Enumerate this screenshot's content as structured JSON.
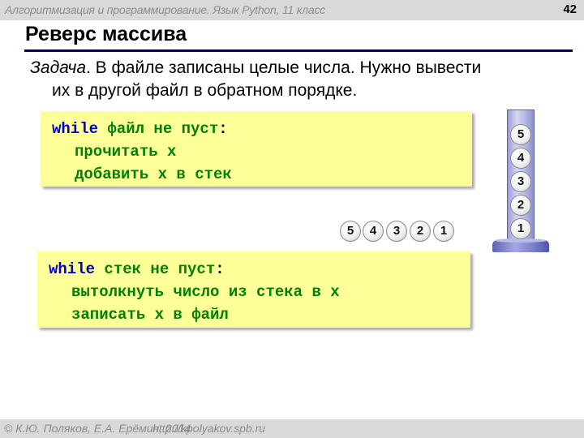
{
  "header": {
    "course_title": "Алгоритмизация и программирование. Язык Python, 11 класс",
    "page_number": "42"
  },
  "slide": {
    "title": "Реверс массива",
    "task": {
      "label": "Задача",
      "text_line1": ". В файле записаны целые числа. Нужно вывести",
      "text_line2": "их в другой файл в обратном порядке."
    }
  },
  "code_blocks": [
    {
      "lines": [
        {
          "keyword": "while",
          "text": " файл не пуст",
          "colon": ":"
        },
        {
          "text": "прочитать x"
        },
        {
          "text": "добавить x в стек"
        }
      ]
    },
    {
      "lines": [
        {
          "keyword": "while",
          "text": " стек не пуст",
          "colon": ":"
        },
        {
          "text": "вытолкнуть число из стека в x"
        },
        {
          "text": "записать x в файл"
        }
      ]
    }
  ],
  "stack_illustration": {
    "stack_top_to_bottom": [
      "5",
      "4",
      "3",
      "2",
      "1"
    ],
    "output_row": [
      "5",
      "4",
      "3",
      "2",
      "1"
    ],
    "tube_color": "#b7bbe6",
    "base_color": "#5c62b5"
  },
  "colors": {
    "code_background": "#ffff99",
    "keyword": "#0000cc",
    "code_text": "#008000",
    "title_rule": "#000066",
    "bar_background": "#d9d9d9"
  },
  "footer": {
    "copyright": "© К.Ю. Поляков, Е.А. Ерёмин, 2014",
    "url": "http://kpolyakov.spb.ru"
  }
}
